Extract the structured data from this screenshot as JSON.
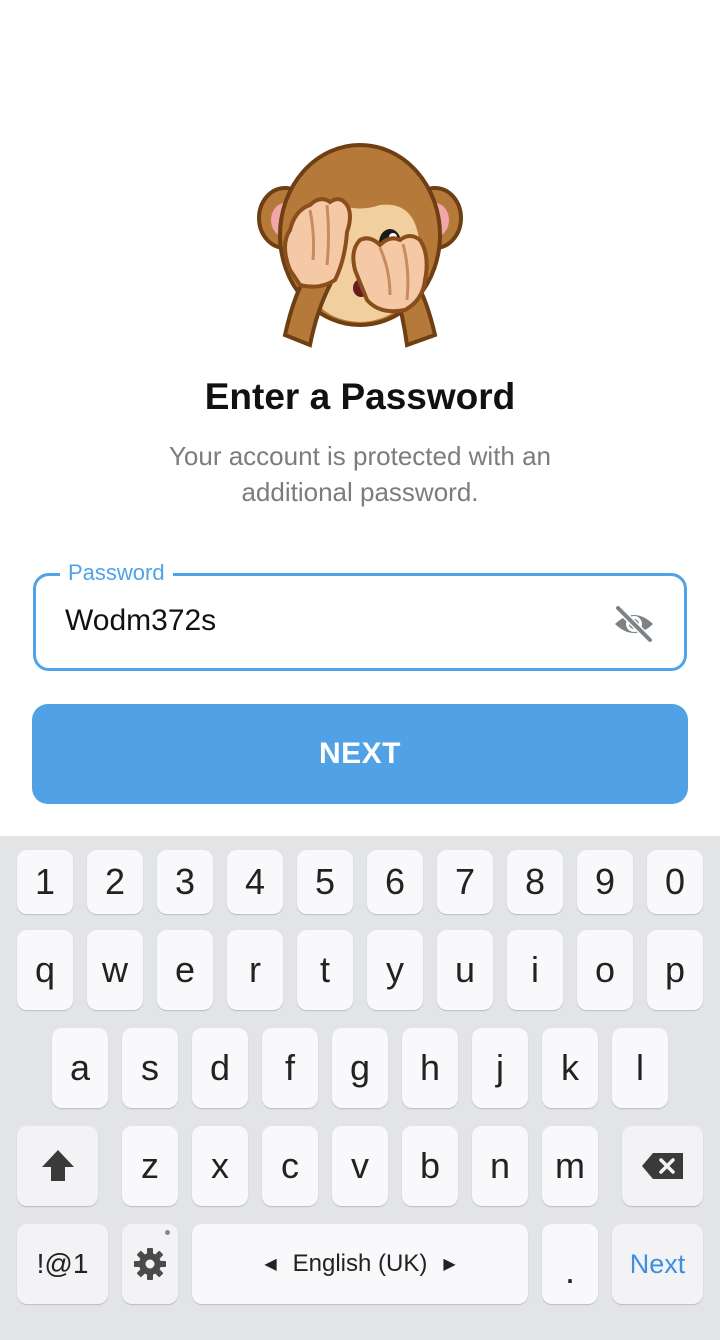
{
  "header": {
    "title": "Enter a Password",
    "subtitle_line1": "Your account is protected with an",
    "subtitle_line2": "additional password."
  },
  "password_field": {
    "label": "Password",
    "value": "Wodm372s",
    "visibility_icon": "eye-off-icon"
  },
  "next_button": {
    "label": "NEXT"
  },
  "keyboard": {
    "number_row": [
      "1",
      "2",
      "3",
      "4",
      "5",
      "6",
      "7",
      "8",
      "9",
      "0"
    ],
    "row1": [
      "q",
      "w",
      "e",
      "r",
      "t",
      "y",
      "u",
      "i",
      "o",
      "p"
    ],
    "row2": [
      "a",
      "s",
      "d",
      "f",
      "g",
      "h",
      "j",
      "k",
      "l"
    ],
    "row3": [
      "z",
      "x",
      "c",
      "v",
      "b",
      "n",
      "m"
    ],
    "symbols_label": "!@1",
    "space_label": "English (UK)",
    "period_label": ".",
    "action_label": "Next",
    "shift_icon": "shift-arrow-icon",
    "backspace_icon": "backspace-icon",
    "settings_icon": "gear-icon"
  },
  "colors": {
    "accent": "#4fa3e8",
    "button": "#50a1e6",
    "keyboard_bg": "#e3e4e6",
    "key_bg": "#f9f9fb"
  }
}
